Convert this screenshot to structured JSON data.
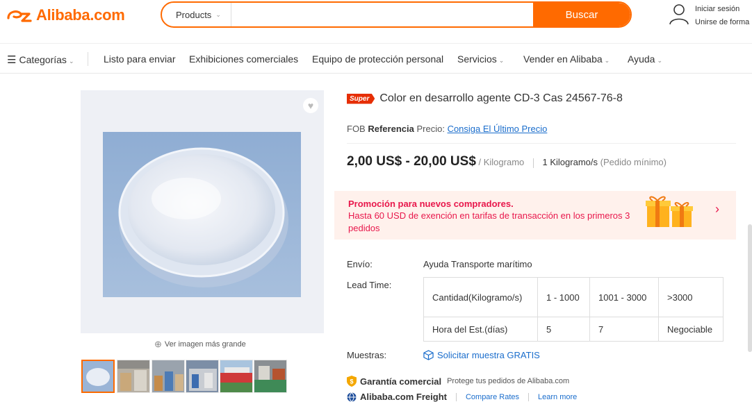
{
  "header": {
    "logo_text": "Alibaba.com",
    "search": {
      "scope": "Products",
      "placeholder": "",
      "button": "Buscar"
    },
    "account": {
      "sign_in": "Iniciar sesión",
      "join": "Unirse de forma"
    }
  },
  "nav": {
    "categories": "Categorías",
    "items": [
      {
        "label": "Listo para enviar"
      },
      {
        "label": "Exhibiciones comerciales"
      },
      {
        "label": "Equipo de protección personal"
      },
      {
        "label": "Servicios"
      },
      {
        "label": "Vender en Alibaba"
      },
      {
        "label": "Ayuda"
      }
    ]
  },
  "gallery": {
    "zoom_label": "Ver imagen más grande"
  },
  "product": {
    "badge": "Super",
    "title": "Color en desarrollo agente CD-3 Cas 24567-76-8",
    "fob": {
      "prefix": "FOB",
      "bold": "Referencia",
      "mid": "Precio:",
      "link": "Consiga El Último Precio"
    },
    "price": {
      "range": "2,00 US$ - 20,00 US$",
      "unit": "/ Kilogramo",
      "moq": "1 Kilogramo/s",
      "moq_note": "(Pedido mínimo)"
    },
    "promo": {
      "title": "Promoción para nuevos compradores.",
      "text": "Hasta 60 USD de exención en tarifas de transacción en los primeros 3 pedidos"
    },
    "shipping": {
      "label": "Envío:",
      "value": "Ayuda Transporte marítimo"
    },
    "lead_time": {
      "label": "Lead Time:",
      "rows": [
        [
          "Cantidad(Kilogramo/s)",
          "1 - 1000",
          "1001 - 3000",
          ">3000"
        ],
        [
          "Hora del Est.(días)",
          "5",
          "7",
          "Negociable"
        ]
      ]
    },
    "samples": {
      "label": "Muestras:",
      "link": "Solicitar muestra GRATIS"
    },
    "guarantee": {
      "title": "Garantía comercial",
      "text": "Protege tus pedidos de Alibaba.com"
    },
    "freight": {
      "title": "Alibaba.com Freight",
      "link1": "Compare Rates",
      "link2": "Learn more"
    }
  },
  "colors": {
    "accent": "#ff6a00",
    "promo": "#e8174b",
    "link": "#1a6dcc"
  }
}
